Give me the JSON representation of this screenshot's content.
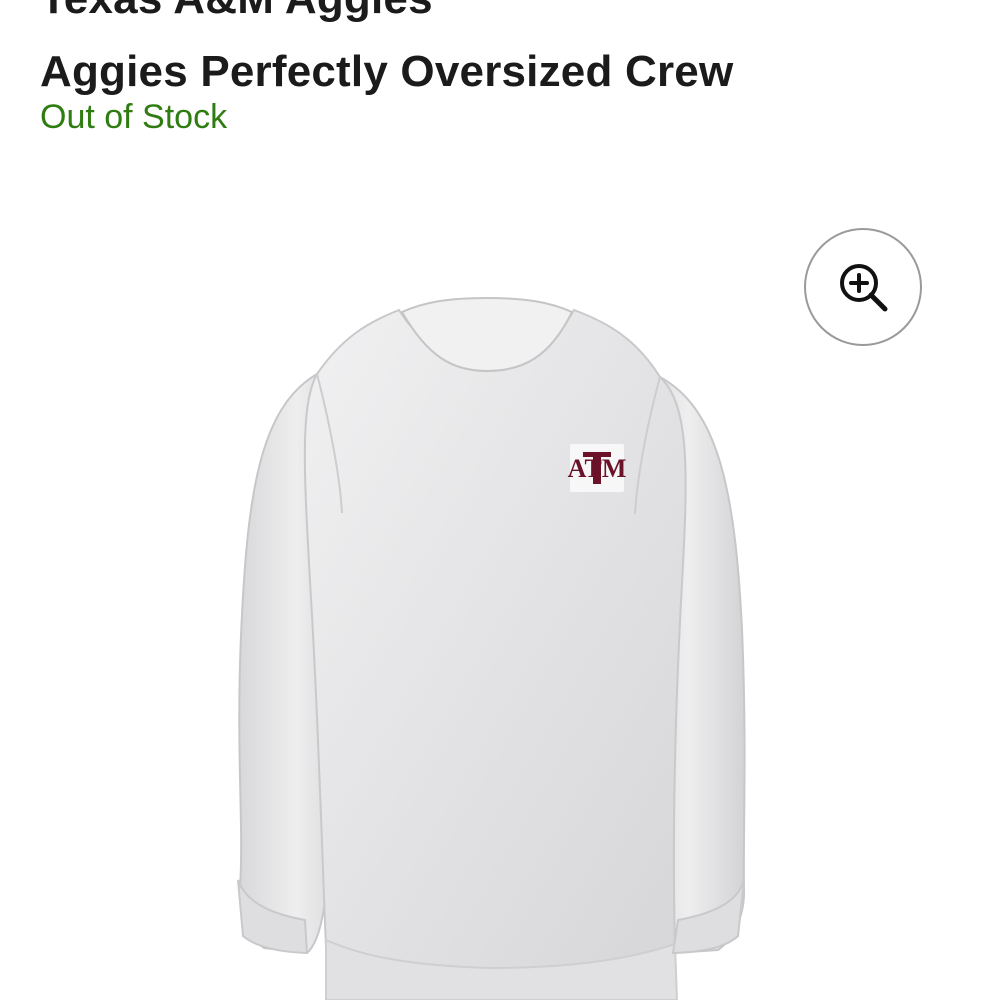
{
  "product": {
    "title_partial": "Texas A&M Aggies",
    "title": "Aggies Perfectly Oversized Crew",
    "stock_status": "Out of Stock",
    "stock_color": "#2f7d12",
    "image": {
      "subject": "oversized crewneck sweatshirt",
      "color": "#e7e7e8",
      "logo": {
        "text": "ATM",
        "color": "#6b1229"
      }
    }
  },
  "zoom_button": {
    "icon": "zoom-in-icon"
  }
}
